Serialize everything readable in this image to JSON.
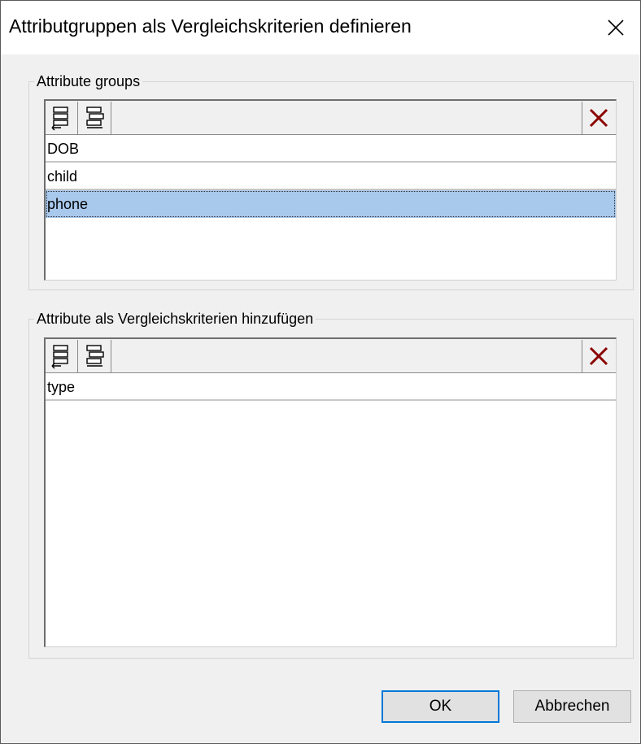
{
  "dialog": {
    "title": "Attributgruppen als Vergleichskriterien definieren"
  },
  "attribute_groups": {
    "legend": "Attribute groups",
    "rows": [
      "DOB",
      "child",
      "phone"
    ],
    "selected": "phone"
  },
  "compare_attributes": {
    "legend": "Attribute als Vergleichskriterien hinzufügen",
    "rows": [
      "type"
    ]
  },
  "buttons": {
    "ok": "OK",
    "cancel": "Abbrechen"
  },
  "icons": {
    "close": "close-icon",
    "insert_row": "insert-row-icon",
    "append_row": "append-row-icon",
    "delete": "delete-icon"
  },
  "colors": {
    "selection": "#a8c8ec",
    "delete_icon": "#8b0000",
    "default_button_border": "#0078d7"
  }
}
